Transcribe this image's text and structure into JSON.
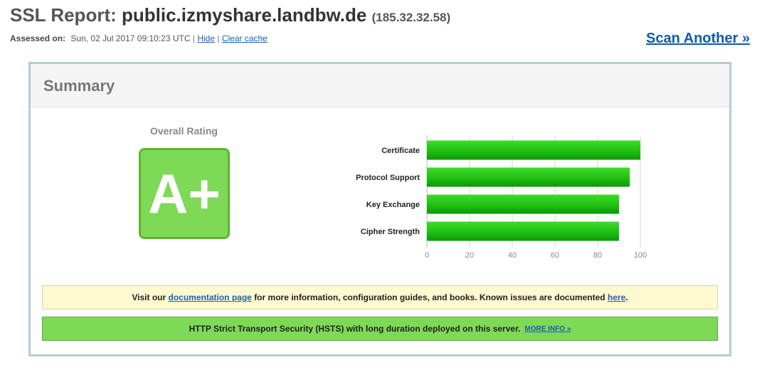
{
  "header": {
    "title_label": "SSL Report:",
    "hostname": "public.izmyshare.landbw.de",
    "ip": "(185.32.32.58)",
    "assessed_label": "Assessed on:",
    "assessed_value": "Sun, 02 Jul 2017 09:10:23 UTC",
    "separator": "|",
    "hide_link": "Hide",
    "clear_cache_link": "Clear cache",
    "scan_another": "Scan Another »"
  },
  "summary": {
    "title": "Summary",
    "overall_rating_label": "Overall Rating",
    "grade": "A+",
    "grade_color": "#7ed957",
    "bar_color": "#1fbf12"
  },
  "chart_data": {
    "type": "bar",
    "orientation": "horizontal",
    "categories": [
      "Certificate",
      "Protocol Support",
      "Key Exchange",
      "Cipher Strength"
    ],
    "values": [
      100,
      95,
      90,
      90
    ],
    "xlim": [
      0,
      100
    ],
    "xticks": [
      "0",
      "20",
      "40",
      "60",
      "80",
      "100"
    ],
    "grid": true
  },
  "notices": {
    "doc_prefix": "Visit our ",
    "doc_link": "documentation page",
    "doc_middle": " for more information, configuration guides, and books. Known issues are documented ",
    "doc_link2": "here",
    "doc_suffix": ".",
    "hsts_text": "HTTP Strict Transport Security (HSTS) with long duration deployed on this server.",
    "hsts_link": "MORE INFO »"
  }
}
